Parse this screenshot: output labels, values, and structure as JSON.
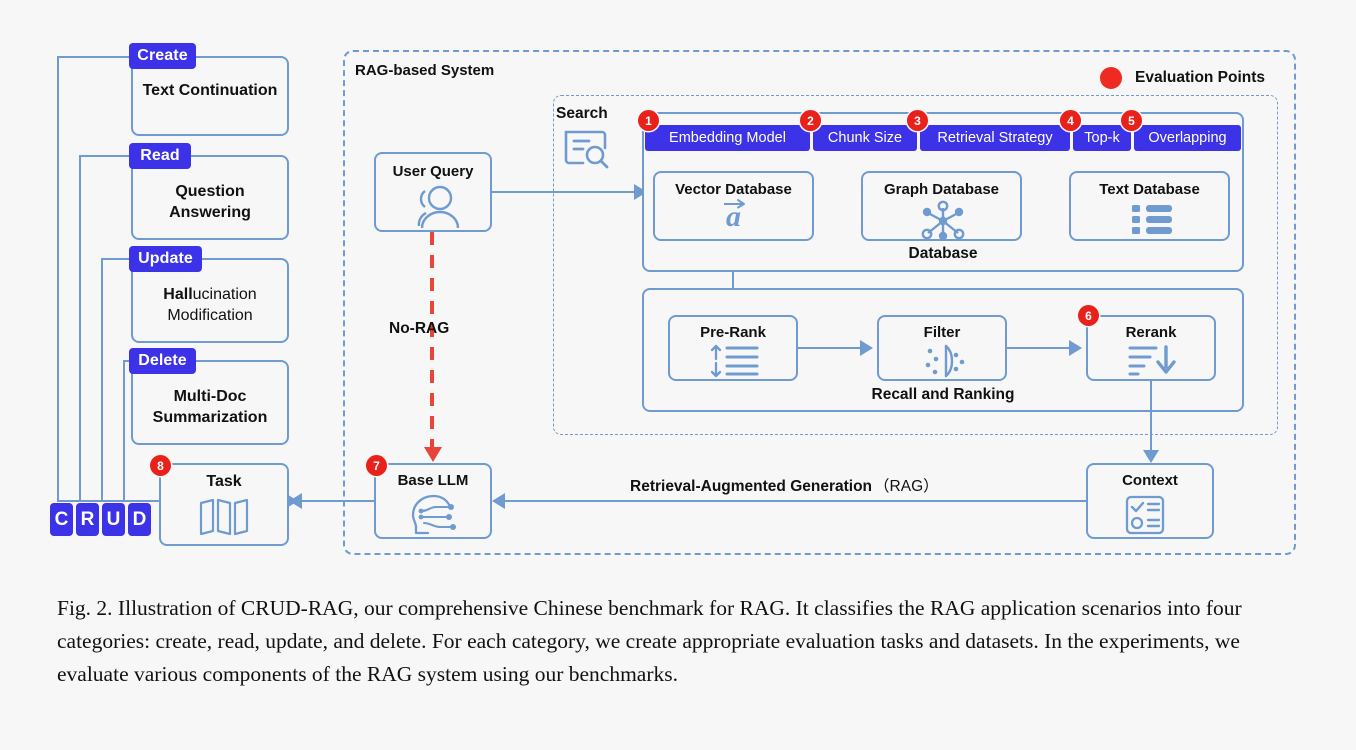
{
  "figure": {
    "caption": "Fig. 2.  Illustration of CRUD-RAG, our comprehensive Chinese benchmark for RAG. It classifies the RAG application scenarios into four categories: create, read, update, and delete. For each category, we create appropriate evaluation tasks and datasets. In the experiments, we evaluate various components of the RAG system using our benchmarks."
  },
  "colors": {
    "accent_blue": "#6f9bd1",
    "badge_purple": "#3c32e8",
    "eval_red": "#e8211a",
    "norag_red": "#e8443a",
    "background": "#f7f7f7"
  },
  "legend": {
    "label": "Evaluation Points",
    "marker_color": "#ee2a22"
  },
  "crud": {
    "categories": [
      {
        "badge": "Create",
        "task": "Text Continuation"
      },
      {
        "badge": "Read",
        "task": "Question Answering"
      },
      {
        "badge": "Update",
        "task": "Hallucination Modification",
        "task_bold_prefix": "Hall",
        "task_rest": "ucination",
        "task_line2": "Modification"
      },
      {
        "badge": "Delete",
        "task": "Multi-Doc Summarization"
      }
    ],
    "letters": [
      "C",
      "R",
      "U",
      "D"
    ],
    "task_box": {
      "title": "Task",
      "eval_point": "8"
    }
  },
  "rag_system": {
    "title": "RAG-based System",
    "user_query": {
      "title": "User Query"
    },
    "no_rag": {
      "label": "No-RAG"
    },
    "search": {
      "label": "Search"
    },
    "tags": [
      {
        "num": "1",
        "label": "Embedding Model"
      },
      {
        "num": "2",
        "label": "Chunk Size"
      },
      {
        "num": "3",
        "label": "Retrieval Strategy"
      },
      {
        "num": "4",
        "label": "Top-k"
      },
      {
        "num": "5",
        "label": "Overlapping"
      }
    ],
    "database": {
      "group_label": "Database",
      "items": [
        "Vector Database",
        "Graph Database",
        "Text Database"
      ]
    },
    "recall_ranking": {
      "group_label": "Recall and Ranking",
      "stages": [
        {
          "label": "Pre-Rank"
        },
        {
          "label": "Filter"
        },
        {
          "label": "Rerank",
          "eval_point": "6"
        }
      ]
    },
    "base_llm": {
      "title": "Base LLM",
      "eval_point": "7"
    },
    "context": {
      "title": "Context"
    },
    "rag_arrow_label": "Retrieval-Augmented Generation",
    "rag_arrow_label_paren": "（RAG）"
  }
}
